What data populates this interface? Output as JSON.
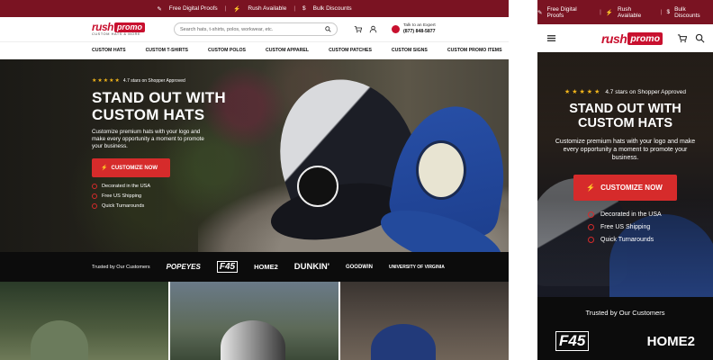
{
  "promo_bar": {
    "items": [
      "Free Digital Proofs",
      "Rush Available",
      "Bulk Discounts"
    ],
    "separator": "|"
  },
  "brand": {
    "rush": "rush",
    "promo": "promo",
    "tagline": "CUSTOM HATS & MORE",
    "accent_color": "#c8102e",
    "bar_color": "#7a1322"
  },
  "search": {
    "placeholder": "Search hats, t-shirts, polos, workwear, etc."
  },
  "expert": {
    "label": "Talk to an Expert",
    "phone": "(877) 848-5877"
  },
  "nav": {
    "items": [
      "CUSTOM HATS",
      "CUSTOM T-SHIRTS",
      "CUSTOM POLOS",
      "CUSTOM APPAREL",
      "CUSTOM PATCHES",
      "CUSTOM SIGNS",
      "CUSTOM PROMO ITEMS"
    ]
  },
  "hero": {
    "rating_text": "4.7 stars on Shopper Approved",
    "stars": "★★★★★",
    "heading_line1": "STAND OUT WITH",
    "heading_line2": "CUSTOM HATS",
    "subtext": "Customize premium hats with your logo and make every opportunity a moment to promote your business.",
    "cta_label": "CUSTOMIZE NOW",
    "cta_icon": "⚡",
    "features": [
      "Decorated in the USA",
      "Free US Shipping",
      "Quick Turnarounds"
    ]
  },
  "trust": {
    "label": "Trusted by Our Customers",
    "brands": [
      "POPEYES",
      "F45",
      "HOME2",
      "DUNKIN'",
      "GOODWIN",
      "UNIVERSITY OF VIRGINIA"
    ],
    "mobile_brands": [
      "F45",
      "HOME2"
    ]
  },
  "mobile": {
    "promo_items": [
      "Free Digital Proofs",
      "Rush Available",
      "Bulk Discounts"
    ],
    "rating_text": "4.7 stars on Shopper Approved",
    "heading_line1": "STAND OUT WITH",
    "heading_line2": "CUSTOM HATS",
    "subtext": "Customize premium hats with your logo and make every opportunity a moment to promote your business.",
    "cta_label": "CUSTOMIZE NOW",
    "features": [
      "Decorated in the USA",
      "Free US Shipping",
      "Quick Turnarounds"
    ],
    "trust_label": "Trusted by Our Customers"
  }
}
